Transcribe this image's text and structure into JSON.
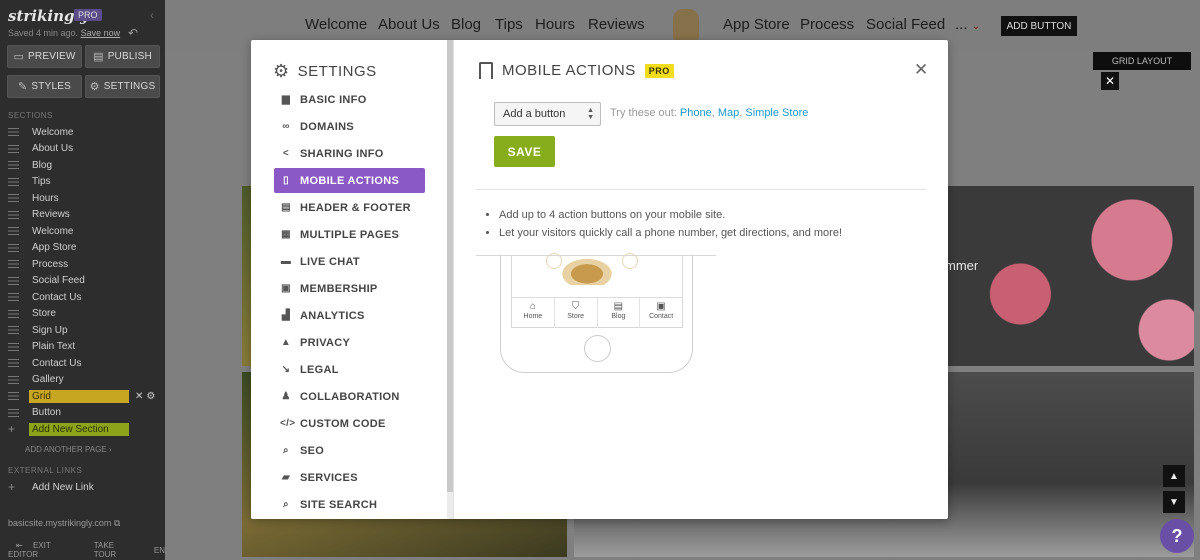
{
  "editor": {
    "logo": "strikingly",
    "pro": "PRO",
    "saved_text": "Saved 4 min ago.",
    "save_now": "Save now",
    "buttons": {
      "preview": "PREVIEW",
      "publish": "PUBLISH",
      "styles": "STYLES",
      "settings": "SETTINGS"
    },
    "sections_header": "SECTIONS",
    "sections": [
      "Welcome",
      "About Us",
      "Blog",
      "Tips",
      "Hours",
      "Reviews",
      "Welcome",
      "App Store",
      "Process",
      "Social Feed",
      "Contact Us",
      "Store",
      "Sign Up",
      "Plain Text",
      "Contact Us",
      "Gallery",
      "Grid",
      "Button",
      "Add New Section"
    ],
    "active_section_index": 16,
    "add_page": "ADD ANOTHER PAGE",
    "external_header": "EXTERNAL LINKS",
    "add_link": "Add New Link",
    "site_url": "basicsite.mystrikingly.com",
    "exit_editor": "EXIT EDITOR",
    "take_tour": "TAKE TOUR",
    "lang": "EN"
  },
  "site": {
    "nav": [
      "Welcome",
      "About Us",
      "Blog",
      "Tips",
      "Hours",
      "Reviews",
      "App Store",
      "Process",
      "Social Feed",
      "..."
    ],
    "nav_add_button": "ADD BUTTON",
    "grid_layout": "GRID LAYOUT",
    "summer_text": "mmer"
  },
  "modal": {
    "menu_title": "SETTINGS",
    "menu": [
      {
        "label": "BASIC INFO",
        "icon": "briefcase-icon"
      },
      {
        "label": "DOMAINS",
        "icon": "link-icon"
      },
      {
        "label": "SHARING INFO",
        "icon": "share-icon"
      },
      {
        "label": "MOBILE ACTIONS",
        "icon": "mobile-icon"
      },
      {
        "label": "HEADER & FOOTER",
        "icon": "header-icon"
      },
      {
        "label": "MULTIPLE PAGES",
        "icon": "pages-icon"
      },
      {
        "label": "LIVE CHAT",
        "icon": "chat-icon"
      },
      {
        "label": "MEMBERSHIP",
        "icon": "id-card-icon"
      },
      {
        "label": "ANALYTICS",
        "icon": "bar-chart-icon"
      },
      {
        "label": "PRIVACY",
        "icon": "lock-icon"
      },
      {
        "label": "LEGAL",
        "icon": "gavel-icon"
      },
      {
        "label": "COLLABORATION",
        "icon": "users-icon"
      },
      {
        "label": "CUSTOM CODE",
        "icon": "code-icon"
      },
      {
        "label": "SEO",
        "icon": "search-icon"
      },
      {
        "label": "SERVICES",
        "icon": "folder-icon"
      },
      {
        "label": "SITE SEARCH",
        "icon": "search-icon"
      }
    ],
    "active_menu_index": 3,
    "title": "MOBILE ACTIONS",
    "pro": "PRO",
    "select_value": "Add a button",
    "try_text": "Try these out:",
    "try_links": [
      "Phone",
      "Map",
      "Simple Store"
    ],
    "save": "SAVE",
    "bullets": [
      "Add up to 4 action buttons on your mobile site.",
      "Let your visitors quickly call a phone number, get directions, and more!"
    ],
    "phone_tabs": [
      "Home",
      "Store",
      "Blog",
      "Contact"
    ]
  },
  "colors": {
    "accent_purple": "#8a59c5",
    "save_green": "#88ad1c",
    "pro_yellow": "#f2dd1c",
    "link_blue": "#1e97cc"
  }
}
